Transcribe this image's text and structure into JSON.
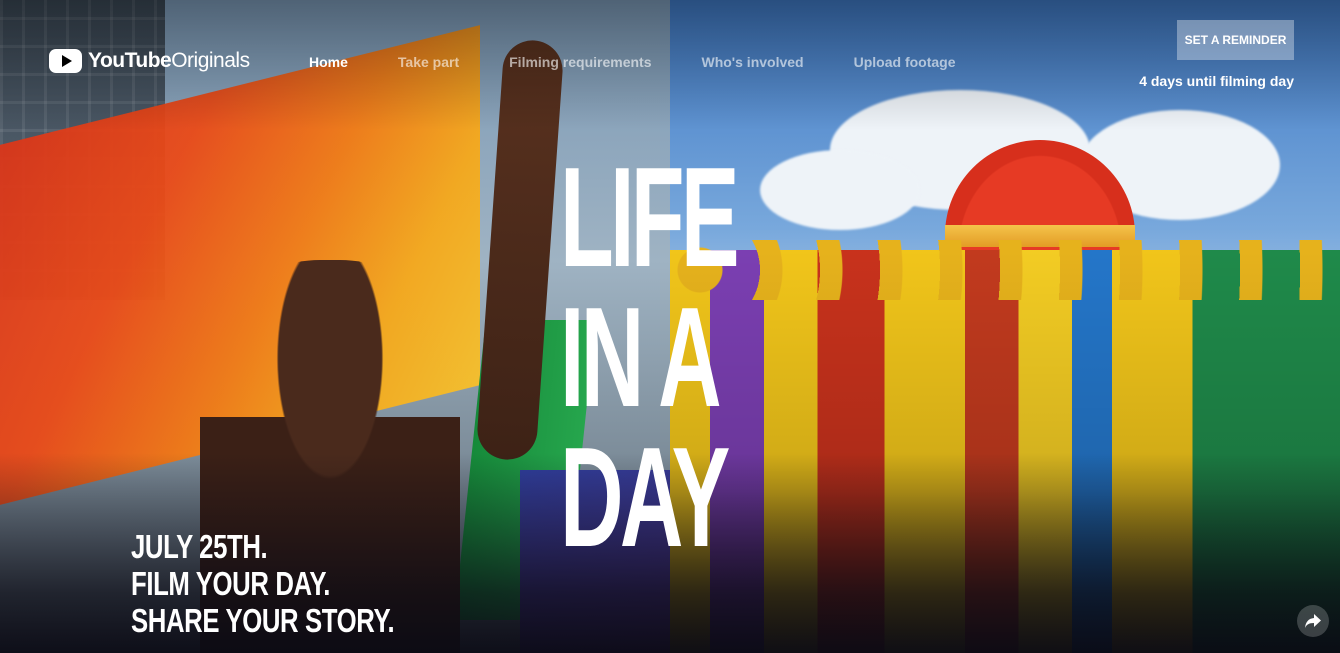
{
  "header": {
    "logo_text_bold": "YouTube",
    "logo_text": "Originals",
    "nav": [
      {
        "label": "Home",
        "active": true
      },
      {
        "label": "Take part",
        "active": false
      },
      {
        "label": "Filming requirements",
        "active": false
      },
      {
        "label": "Who's involved",
        "active": false
      },
      {
        "label": "Upload footage",
        "active": false
      }
    ],
    "reminder_button": "SET A REMINDER",
    "countdown": "4 days until filming day"
  },
  "hero": {
    "title_lines": [
      "LIFE",
      "IN A",
      "DAY"
    ],
    "tagline_lines": [
      "JULY 25TH.",
      "FILM YOUR DAY.",
      "SHARE YOUR STORY."
    ]
  },
  "icons": {
    "logo": "youtube-play-icon",
    "share": "share-arrow-icon"
  }
}
